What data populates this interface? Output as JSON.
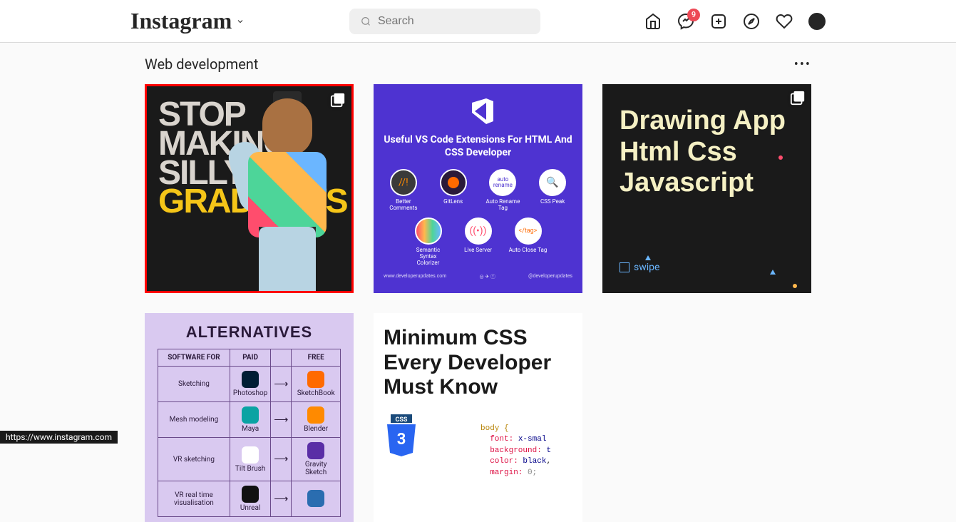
{
  "logo": "Instagram",
  "search": {
    "placeholder": "Search"
  },
  "badge_count": "9",
  "page_title": "Web development",
  "status_url": "https://www.instagram.com",
  "tile1": {
    "l1": "STOP",
    "l2": "MAKING",
    "l3": "SILLY",
    "l4": "GRADIENTS"
  },
  "tile2": {
    "title": "Useful VS Code Extensions For HTML And CSS Developer",
    "items": [
      "Better Comments",
      "GitLens",
      "Auto Rename Tag",
      "CSS Peak",
      "Semantic Syntax Colorizer",
      "Live Server",
      "Auto Close Tag"
    ],
    "footer_left": "www.developerupdates.com",
    "footer_right": "@developerupdates"
  },
  "tile3": {
    "title": "Drawing App Html Css Javascript",
    "swipe": "swipe"
  },
  "tile4": {
    "title": "ALTERNATIVES",
    "headers": [
      "SOFTWARE FOR",
      "PAID",
      "",
      "FREE"
    ],
    "rows": [
      {
        "cat": "Sketching",
        "paid": "Photoshop",
        "paid_bg": "#001d34",
        "free": "SketchBook",
        "free_bg": "#ff6a00"
      },
      {
        "cat": "Mesh modeling",
        "paid": "Maya",
        "paid_bg": "#0aa3a3",
        "free": "Blender",
        "free_bg": "#ff8a00"
      },
      {
        "cat": "VR sketching",
        "paid": "Tilt Brush",
        "paid_bg": "#ffffff",
        "free": "Gravity Sketch",
        "free_bg": "#5a2ea6"
      },
      {
        "cat": "VR real time visualisation",
        "paid": "Unreal",
        "paid_bg": "#111111",
        "free": "",
        "free_bg": "#2a6db0"
      }
    ]
  },
  "tile5": {
    "title": "Minimum CSS Every Developer Must Know",
    "badge": "CSS",
    "code": {
      "sel": "body {",
      "p1": "font:",
      "v1": "x-smal",
      "p2": "background:",
      "v2": "t",
      "p3": "color:",
      "v3": "black",
      "p4": "margin:",
      "v4": "0;"
    }
  }
}
